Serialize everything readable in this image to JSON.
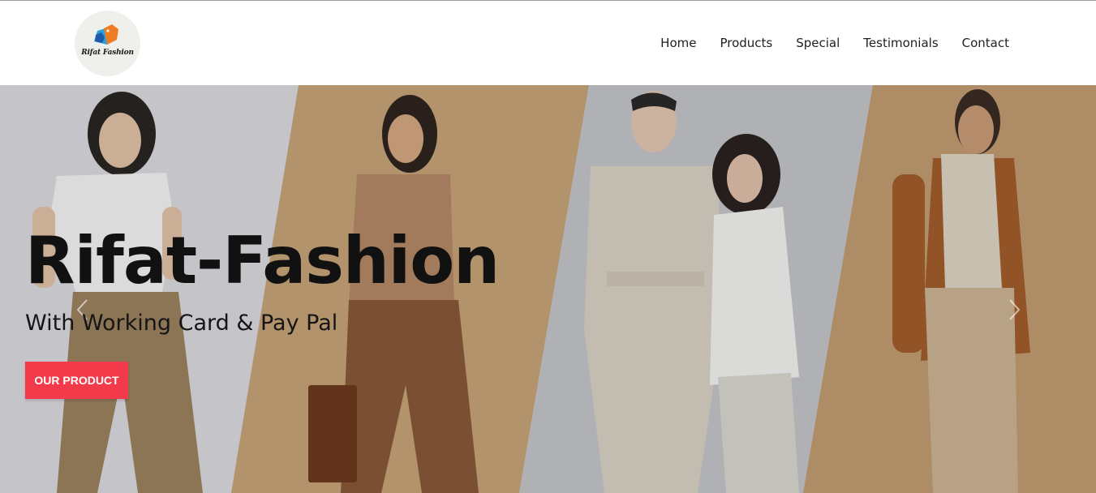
{
  "brand": {
    "logo_text": "Rifat Fashion"
  },
  "nav": {
    "items": [
      "Home",
      "Products",
      "Special",
      "Testimonials",
      "Contact"
    ]
  },
  "hero": {
    "title": "Rifat-Fashion",
    "subtitle": "With Working Card & Pay Pal",
    "button_label": "OUR PRODUCT",
    "colors": {
      "button": "#f23a4a",
      "panel_1": "#d8d7dc",
      "panel_2": "#c6a174",
      "panel_3": "#c3c4c7",
      "panel_4": "#c09b70"
    }
  },
  "icons": {
    "prev": "chevron-left-icon",
    "next": "chevron-right-icon",
    "logo": "tag-logo-icon"
  }
}
